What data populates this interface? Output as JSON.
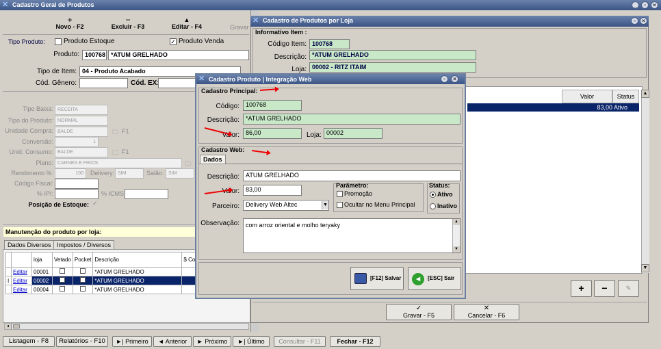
{
  "main": {
    "title": "Cadastro Geral de Produtos",
    "toolbar": {
      "novo": "Novo - F2",
      "excluir": "Excluir - F3",
      "editar": "Editar - F4",
      "gravar": "Gravar"
    },
    "tipo_produto_label": "Tipo Produto:",
    "produto_estoque": "Produto Estoque",
    "produto_venda": "Produto Venda",
    "produto_label": "Produto:",
    "produto_code": "100768",
    "produto_name": "*ATUM GRELHADO",
    "tipo_item_label": "Tipo de Item:",
    "tipo_item": "04 - Produto Acabado",
    "cod_genero_label": "Cód. Gênero:",
    "cod_ex_label": "Cód. EX:",
    "tipo_baixa_label": "Tipo Baixa:",
    "tipo_baixa": "RECEITA",
    "tipo_do_produto_label": "Tipo do Produto:",
    "tipo_do_produto": "NORMAL",
    "unidade_compra_label": "Unidade Compra:",
    "unidade_compra": "BALDE",
    "f1a": "F1",
    "conversao_label": "Conversão:",
    "conversao": "1",
    "unid_consumo_label": "Unid. Consumo:",
    "unid_consumo": "BALDE",
    "f1b": "F1",
    "plano_label": "Plano:",
    "plano": "CARNES E FRIOS",
    "rendimento_label": "Rendimento %:",
    "rendimento": "100",
    "delivery_label": "Delivery:",
    "delivery": "SIM",
    "salao_label": "Salão:",
    "salao": "SIM",
    "codigo_fiscal_label": "Código Fiscal:",
    "ipi_label": "% IPI:",
    "icms_label": "% ICMS :",
    "posicao_label": "Posição de Estoque:",
    "manut_label": "Manutenção do produto por loja:",
    "tabs": [
      "Dados Diversos",
      "Impostos / Diversos"
    ],
    "grid_headers": [
      "",
      "loja",
      "Vetado",
      "Pocket",
      "Descrição",
      "$ Co"
    ],
    "grid_rows": [
      {
        "edit": "Editar",
        "loja": "00001",
        "desc": "*ATUM GRELHADO"
      },
      {
        "edit": "Editar",
        "loja": "00002",
        "desc": "*ATUM GRELHADO"
      },
      {
        "edit": "Editar",
        "loja": "00004",
        "desc": "*ATUM GRELHADO"
      }
    ],
    "bottom": {
      "listagem": "Listagem - F8",
      "relatorios": "Relatórios - F10",
      "primeiro": "Primeiro",
      "anterior": "Anterior",
      "proximo": "Próximo",
      "ultimo": "Último",
      "consultar": "Consultar - F11",
      "fechar": "Fechar - F12"
    }
  },
  "loja": {
    "title": "Cadastro de Produtos por Loja",
    "info_label": "Informativo Item :",
    "codigo_label": "Código Item:",
    "codigo": "100768",
    "descricao_label": "Descrição:",
    "descricao": "*ATUM GRELHADO",
    "loja_label": "Loja:",
    "loja": "00002 - RITZ ITAIM",
    "grid_headers": [
      "Valor",
      "Status"
    ],
    "grid_row": {
      "valor": "83,00",
      "status": "Ativo"
    },
    "gravar": "Gravar - F5",
    "cancelar": "Cancelar - F6"
  },
  "dialog": {
    "title": "Cadastro Produto | Integração Web",
    "principal_label": "Cadastro Principal:",
    "codigo_label": "Código:",
    "codigo": "100768",
    "descricao_label": "Descrição:",
    "descricao": "*ATUM GRELHADO",
    "valor_label": "Valor:",
    "valor": "86,00",
    "loja_label": "Loja:",
    "loja": "00002",
    "web_label": "Cadastro Web:",
    "tab": "Dados",
    "web_descricao_label": "Descrição:",
    "web_descricao": "ATUM GRELHADO",
    "web_valor_label": "Valor:",
    "web_valor": "83,00",
    "parametro_label": "Parâmetro:",
    "promocao": "Promoção",
    "ocultar": "Ocultar no Menu Principal",
    "status_label": "Status:",
    "ativo": "Ativo",
    "inativo": "Inativo",
    "parceiro_label": "Parceiro:",
    "parceiro": "Delivery Web Altec",
    "observacao_label": "Observação:",
    "observacao": "com arroz oriental e molho teryaky",
    "salvar": "[F12] Salvar",
    "sair": "[ESC] Sair"
  }
}
